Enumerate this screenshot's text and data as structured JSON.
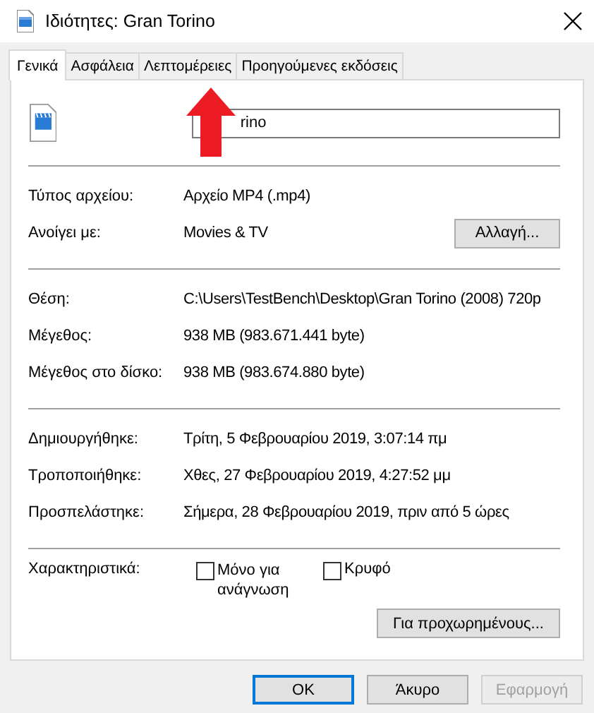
{
  "window": {
    "title": "Ιδιότητες: Gran Torino"
  },
  "tabs": [
    {
      "label": "Γενικά",
      "selected": true
    },
    {
      "label": "Ασφάλεια",
      "selected": false
    },
    {
      "label": "Λεπτομέρειες",
      "selected": false
    },
    {
      "label": "Προηγούμενες εκδόσεις",
      "selected": false
    }
  ],
  "name_field": {
    "value": "rino"
  },
  "sections": [
    [
      {
        "label": "Τύπος αρχείου:",
        "value": "Αρχείο MP4 (.mp4)"
      },
      {
        "label": "Ανοίγει με:",
        "value": "Movies & TV",
        "button": "Αλλαγή..."
      }
    ],
    [
      {
        "label": "Θέση:",
        "value": "C:\\Users\\TestBench\\Desktop\\Gran Torino (2008) 720p"
      },
      {
        "label": "Μέγεθος:",
        "value": "938 MB (983.671.441 byte)"
      },
      {
        "label": "Μέγεθος στο δίσκο:",
        "value": "938 MB (983.674.880 byte)"
      }
    ],
    [
      {
        "label": "Δημιουργήθηκε:",
        "value": "Τρίτη, 5 Φεβρουαρίου 2019, 3:07:14 πμ"
      },
      {
        "label": "Τροποποιήθηκε:",
        "value": "Χθες, 27 Φεβρουαρίου 2019, 4:27:52 μμ"
      },
      {
        "label": "Προσπελάστηκε:",
        "value": "Σήμερα, 28 Φεβρουαρίου 2019, πριν από 5 ώρες"
      }
    ]
  ],
  "attributes": {
    "label": "Χαρακτηριστικά:",
    "items": [
      {
        "label": "Μόνο για ανάγνωση",
        "checked": false
      },
      {
        "label": "Κρυφό",
        "checked": false
      }
    ],
    "advanced_button": "Για προχωρημένους..."
  },
  "buttons": [
    {
      "label": "OK",
      "default": true,
      "disabled": false
    },
    {
      "label": "Άκυρο",
      "default": false,
      "disabled": false
    },
    {
      "label": "Εφαρμογή",
      "default": false,
      "disabled": true
    }
  ]
}
